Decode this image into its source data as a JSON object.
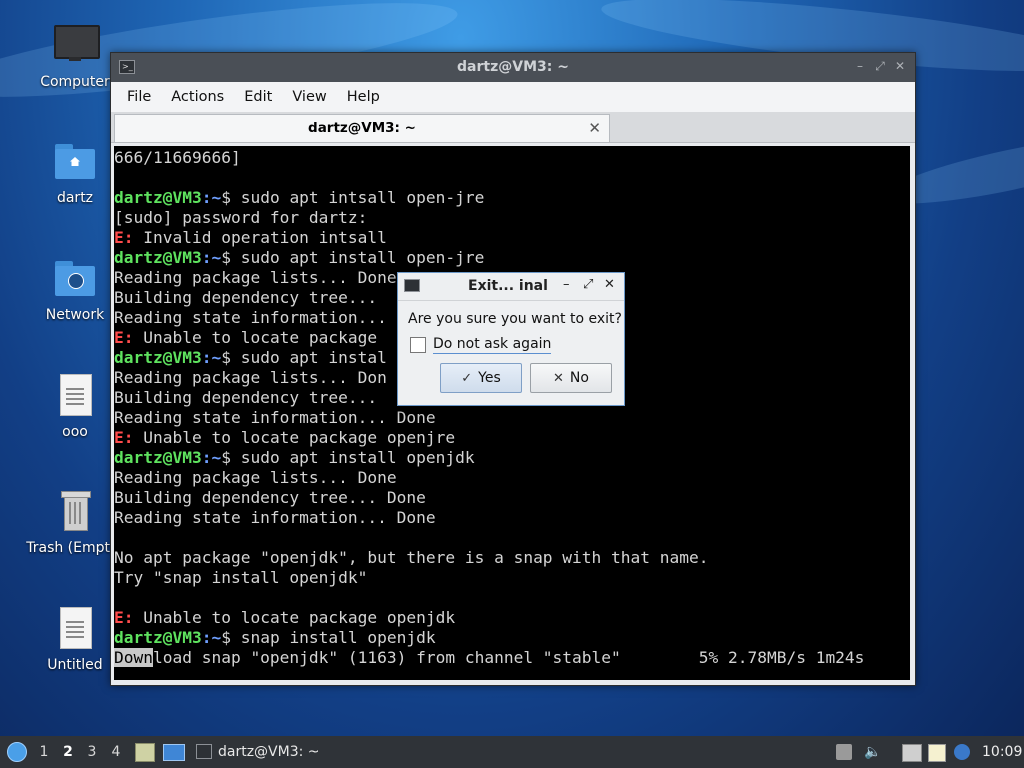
{
  "desktop": {
    "icons": [
      {
        "name": "computer",
        "label": "Computer"
      },
      {
        "name": "home-folder",
        "label": "dartz"
      },
      {
        "name": "network",
        "label": "Network"
      },
      {
        "name": "file-ooo",
        "label": "ooo"
      },
      {
        "name": "trash",
        "label": "Trash (Empty)"
      },
      {
        "name": "file-untitled",
        "label": "Untitled"
      }
    ]
  },
  "window": {
    "title": "dartz@VM3: ~",
    "menu": [
      "File",
      "Actions",
      "Edit",
      "View",
      "Help"
    ],
    "tab_label": "dartz@VM3: ~",
    "terminal": {
      "line01": "666/11669666]",
      "prompt_user": "dartz@VM3",
      "prompt_path": ":~",
      "error_tag": "E:",
      "cmd1": "$ sudo apt intsall open-jre",
      "line02": "[sudo] password for dartz:",
      "err1": " Invalid operation intsall",
      "cmd2": "$ sudo apt install open-jre",
      "read1": "Reading package lists... Done",
      "build1": "Building dependency tree...",
      "state1": "Reading state information...",
      "err2": " Unable to locate package",
      "cmd3": "$ sudo apt instal",
      "read2": "Reading package lists... Don",
      "build2": "Building dependency tree...",
      "state2": "Reading state information... Done",
      "err3": " Unable to locate package openjre",
      "cmd4": "$ sudo apt install openjdk",
      "read3": "Reading package lists... Done",
      "build3": "Building dependency tree... Done",
      "state3": "Reading state information... Done",
      "snap_hint1": "No apt package \"openjdk\", but there is a snap with that name.",
      "snap_hint2": "Try \"snap install openjdk\"",
      "err4": " Unable to locate package openjdk",
      "cmd5": "$ snap install openjdk",
      "progress_selected": "Down",
      "progress_rest": "load snap \"openjdk\" (1163) from channel \"stable\"        5% 2.78MB/s 1m24s"
    }
  },
  "dialog": {
    "title": "Exit... inal",
    "message": "Are you sure you want to exit?",
    "checkbox_label": "Do not ask again",
    "checkbox_checked": false,
    "yes_label": "Yes",
    "no_label": "No"
  },
  "taskbar": {
    "workspaces": [
      "1",
      "2",
      "3",
      "4"
    ],
    "active_workspace": "2",
    "task_label": "dartz@VM3: ~",
    "clock": "10:09"
  },
  "colors": {
    "prompt_user": "#5fe35f",
    "prompt_path": "#6f9fff",
    "error": "#ff4b4b",
    "terminal_bg": "#000000",
    "taskbar_bg": "#2f3338"
  }
}
